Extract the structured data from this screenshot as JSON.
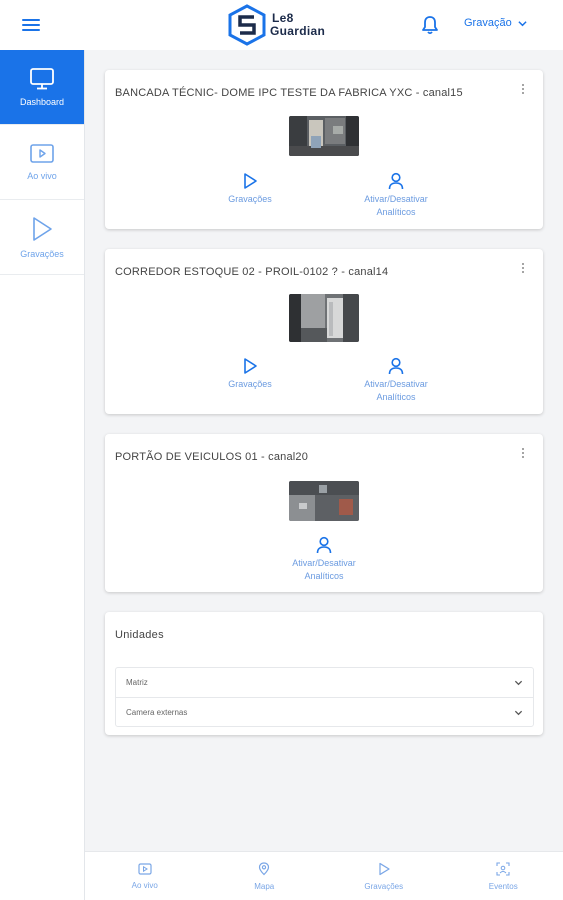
{
  "header": {
    "logo_line1": "Le8",
    "logo_line2": "Guardian",
    "user_menu_label": "Gravação"
  },
  "sidebar": {
    "items": [
      {
        "label": "Dashboard",
        "icon": "monitor-icon",
        "active": true
      },
      {
        "label": "Ao vivo",
        "icon": "live-video-icon",
        "active": false
      },
      {
        "label": "Gravações",
        "icon": "play-icon",
        "active": false
      }
    ]
  },
  "cameras": [
    {
      "title": "BANCADA TÉCNIC- DOME IPC TESTE DA FABRICA YXC - canal15",
      "recordings_label": "Gravações",
      "analytics_label_line1": "Ativar/Desativar",
      "analytics_label_line2": "Analíticos"
    },
    {
      "title": "CORREDOR ESTOQUE 02 - PROIL-0102 ? - canal14",
      "recordings_label": "Gravações",
      "analytics_label_line1": "Ativar/Desativar",
      "analytics_label_line2": "Analíticos"
    },
    {
      "title": "PORTÃO DE VEICULOS 01 - canal20",
      "analytics_label_line1": "Ativar/Desativar",
      "analytics_label_line2": "Analíticos"
    }
  ],
  "units": {
    "title": "Unidades",
    "items": [
      "Matriz",
      "Camera externas"
    ]
  },
  "bottom_nav": {
    "items": [
      {
        "label": "Ao vivo",
        "icon": "live-video-icon"
      },
      {
        "label": "Mapa",
        "icon": "map-pin-icon"
      },
      {
        "label": "Gravações",
        "icon": "play-icon"
      },
      {
        "label": "Eventos",
        "icon": "events-icon"
      }
    ]
  },
  "colors": {
    "accent": "#1a73e8",
    "background": "#f3f4f6",
    "muted_blue": "#6ea3ea"
  }
}
